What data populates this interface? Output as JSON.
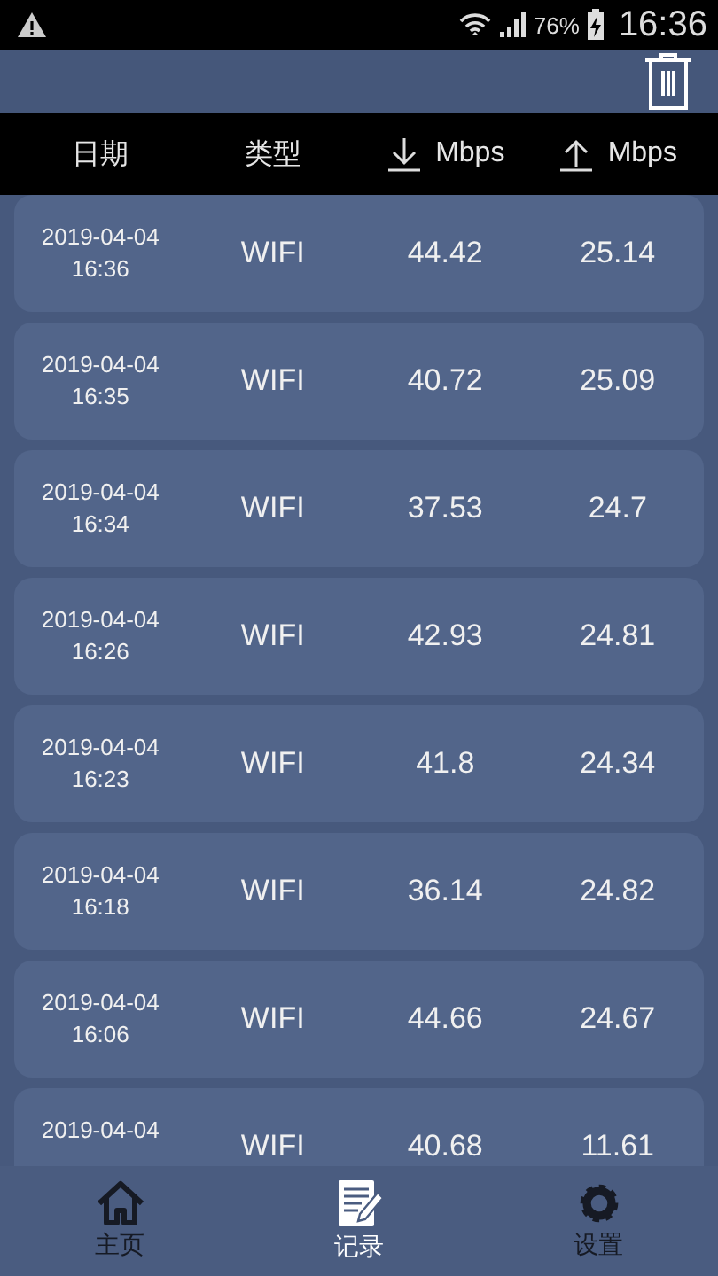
{
  "status_bar": {
    "battery": "76%",
    "time": "16:36"
  },
  "columns": [
    {
      "kind": "text",
      "label": "日期"
    },
    {
      "kind": "text",
      "label": "类型"
    },
    {
      "kind": "down",
      "label": "Mbps"
    },
    {
      "kind": "up",
      "label": "Mbps"
    }
  ],
  "rows": [
    {
      "date": "2019-04-04",
      "time": "16:36",
      "type": "WIFI",
      "download": "44.42",
      "upload": "25.14"
    },
    {
      "date": "2019-04-04",
      "time": "16:35",
      "type": "WIFI",
      "download": "40.72",
      "upload": "25.09"
    },
    {
      "date": "2019-04-04",
      "time": "16:34",
      "type": "WIFI",
      "download": "37.53",
      "upload": "24.7"
    },
    {
      "date": "2019-04-04",
      "time": "16:26",
      "type": "WIFI",
      "download": "42.93",
      "upload": "24.81"
    },
    {
      "date": "2019-04-04",
      "time": "16:23",
      "type": "WIFI",
      "download": "41.8",
      "upload": "24.34"
    },
    {
      "date": "2019-04-04",
      "time": "16:18",
      "type": "WIFI",
      "download": "36.14",
      "upload": "24.82"
    },
    {
      "date": "2019-04-04",
      "time": "16:06",
      "type": "WIFI",
      "download": "44.66",
      "upload": "24.67"
    },
    {
      "date": "2019-04-04",
      "type": "WIFI",
      "download": "40.68",
      "upload": "11.61"
    }
  ],
  "nav": [
    {
      "kind": "home",
      "label": "主页",
      "selected": false
    },
    {
      "kind": "record",
      "label": "记录",
      "selected": true
    },
    {
      "kind": "settings",
      "label": "设置",
      "selected": false
    }
  ]
}
